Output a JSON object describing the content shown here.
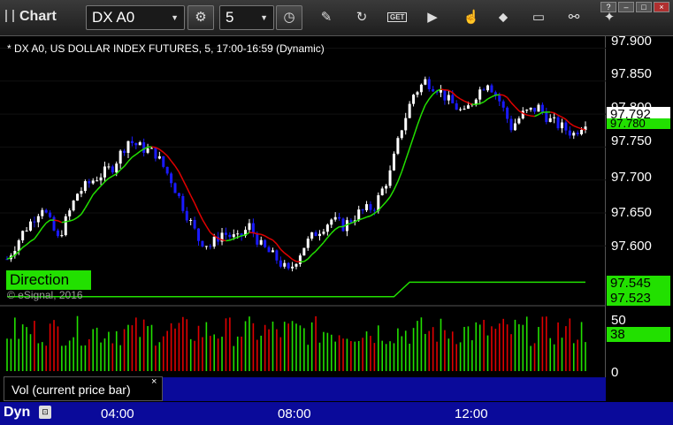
{
  "toolbar": {
    "app_title": "Chart",
    "symbol": "DX A0",
    "interval": "5",
    "get_label": "GET"
  },
  "chart": {
    "description": "* DX A0, US DOLLAR INDEX FUTURES, 5, 17:00-16:59 (Dynamic)",
    "study_label": "Direction",
    "copyright": "© eSignal, 2016"
  },
  "price_axis": {
    "ticks": [
      "97.900",
      "97.850",
      "97.800",
      "97.750",
      "97.700",
      "97.650",
      "97.600"
    ],
    "last_price": "97.792",
    "ma_price": "97.780",
    "direction_upper": "97.545",
    "direction_lower": "97.523"
  },
  "volume_axis": {
    "ticks": [
      "50",
      "0"
    ],
    "current": "38"
  },
  "volume_panel": {
    "label": "Vol (current price bar)",
    "close": "×"
  },
  "time_axis": {
    "labels": [
      "04:00",
      "08:00",
      "12:00"
    ]
  },
  "status": {
    "mode": "Dyn"
  },
  "colors": {
    "up_candle": "#ffffff",
    "down_candle": "#1a1aff",
    "ma_up": "#22e000",
    "ma_down": "#e00000",
    "direction": "#22e000"
  },
  "chart_data": {
    "type": "candlestick",
    "yrange": [
      97.52,
      97.91
    ],
    "close_path": [
      [
        0,
        97.58
      ],
      [
        4,
        97.62
      ],
      [
        9,
        97.66
      ],
      [
        13,
        97.61
      ],
      [
        18,
        97.68
      ],
      [
        22,
        97.7
      ],
      [
        27,
        97.72
      ],
      [
        31,
        97.76
      ],
      [
        34,
        97.75
      ],
      [
        38,
        97.74
      ],
      [
        42,
        97.7
      ],
      [
        45,
        97.66
      ],
      [
        49,
        97.61
      ],
      [
        52,
        97.6
      ],
      [
        55,
        97.62
      ],
      [
        59,
        97.61
      ],
      [
        62,
        97.63
      ],
      [
        65,
        97.6
      ],
      [
        69,
        97.58
      ],
      [
        72,
        97.56
      ],
      [
        76,
        97.6
      ],
      [
        79,
        97.62
      ],
      [
        83,
        97.64
      ],
      [
        86,
        97.63
      ],
      [
        90,
        97.65
      ],
      [
        94,
        97.66
      ],
      [
        98,
        97.71
      ],
      [
        101,
        97.78
      ],
      [
        104,
        97.83
      ],
      [
        107,
        97.85
      ],
      [
        110,
        97.84
      ],
      [
        113,
        97.82
      ],
      [
        117,
        97.8
      ],
      [
        120,
        97.83
      ],
      [
        123,
        97.85
      ],
      [
        126,
        97.82
      ],
      [
        129,
        97.78
      ],
      [
        132,
        97.8
      ],
      [
        136,
        97.81
      ],
      [
        139,
        97.79
      ],
      [
        142,
        97.78
      ],
      [
        145,
        97.77
      ],
      [
        148,
        97.79
      ]
    ],
    "direction_line": [
      [
        0,
        97.523
      ],
      [
        99,
        97.523
      ],
      [
        103,
        97.545
      ],
      [
        148,
        97.545
      ]
    ]
  }
}
